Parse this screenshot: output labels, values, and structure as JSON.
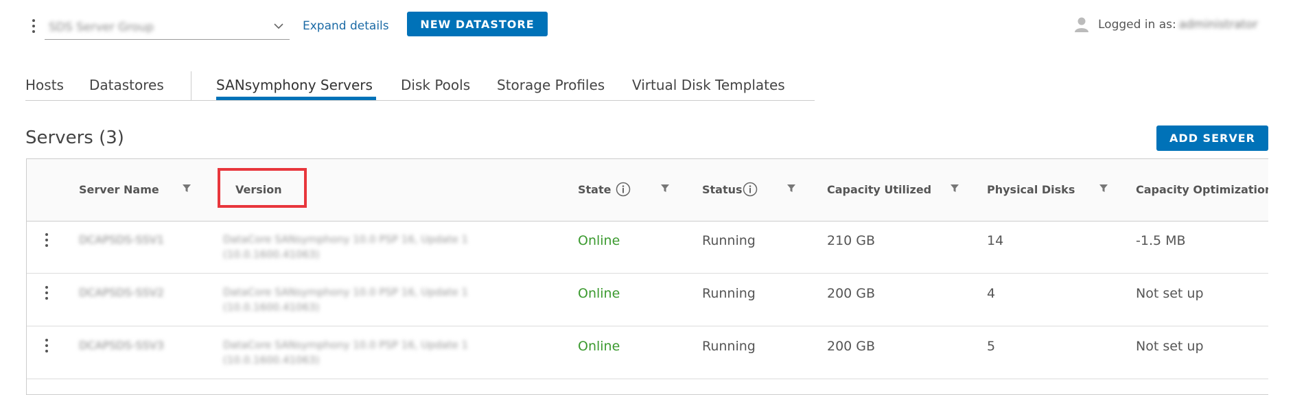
{
  "header": {
    "group_value": "SDS Server Group",
    "expand_details": "Expand details",
    "new_datastore": "NEW DATASTORE",
    "logged_in_label": "Logged in as:",
    "logged_in_user": "administrator"
  },
  "tabs": [
    {
      "label": "Hosts"
    },
    {
      "label": "Datastores"
    },
    {
      "label": "SANsymphony Servers",
      "active": true
    },
    {
      "label": "Disk Pools"
    },
    {
      "label": "Storage Profiles"
    },
    {
      "label": "Virtual Disk Templates"
    }
  ],
  "servers": {
    "title": "Servers (3)",
    "add_button": "ADD SERVER",
    "columns": [
      "Server Name",
      "Version",
      "State",
      "Status",
      "Capacity Utilized",
      "Physical Disks",
      "Capacity Optimization"
    ],
    "rows": [
      {
        "name": "DCAPSDS-SSV1",
        "version_line1": "DataCore SANsymphony 10.0 PSP 16, Update 1",
        "version_line2": "(10.0.1600.41063)",
        "state": "Online",
        "status": "Running",
        "capacity": "210 GB",
        "disks": "14",
        "optimization": "-1.5 MB"
      },
      {
        "name": "DCAPSDS-SSV2",
        "version_line1": "DataCore SANsymphony 10.0 PSP 16, Update 1",
        "version_line2": "(10.0.1600.41063)",
        "state": "Online",
        "status": "Running",
        "capacity": "200 GB",
        "disks": "4",
        "optimization": "Not set up"
      },
      {
        "name": "DCAPSDS-SSV3",
        "version_line1": "DataCore SANsymphony 10.0 PSP 16, Update 1",
        "version_line2": "(10.0.1600.41063)",
        "state": "Online",
        "status": "Running",
        "capacity": "200 GB",
        "disks": "5",
        "optimization": "Not set up"
      }
    ]
  },
  "colors": {
    "accent": "#0072b8",
    "online": "#3b9a2f",
    "highlight": "#e8363c"
  }
}
